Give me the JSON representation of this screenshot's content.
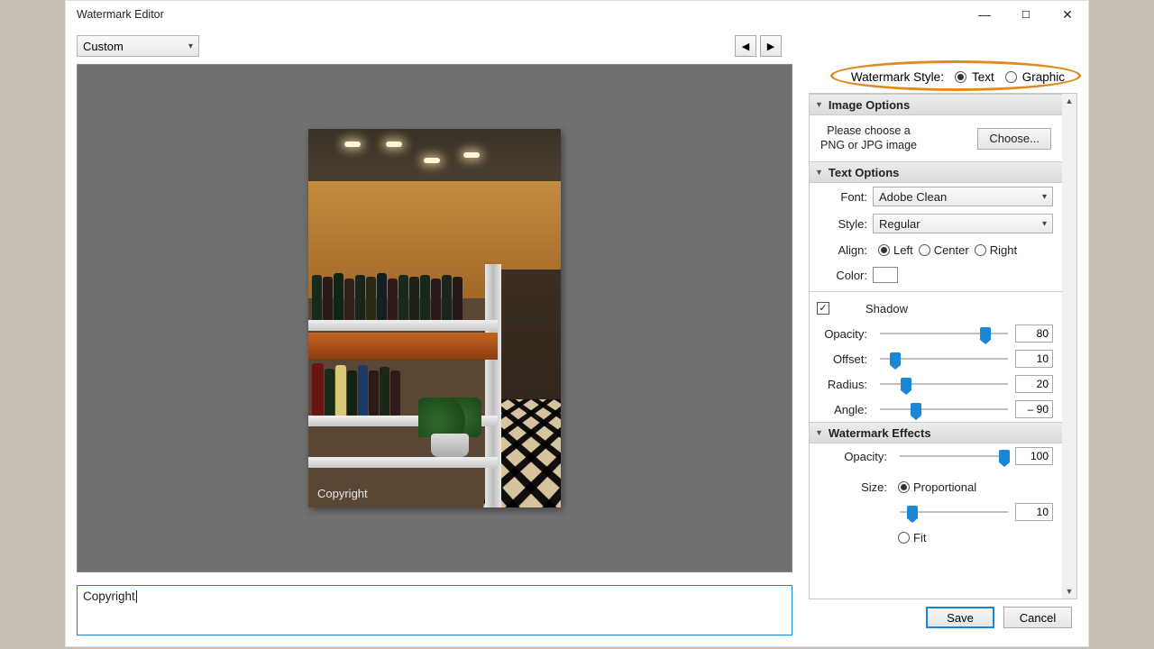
{
  "window": {
    "title": "Watermark Editor"
  },
  "preset": {
    "value": "Custom"
  },
  "watermark_text": "Copyright",
  "caption": "Copyright",
  "style_row": {
    "label": "Watermark Style:",
    "text": "Text",
    "graphic": "Graphic",
    "selected": "text"
  },
  "sections": {
    "image": {
      "title": "Image Options",
      "hint1": "Please choose a",
      "hint2": "PNG or JPG image",
      "choose": "Choose..."
    },
    "text": {
      "title": "Text Options",
      "font_label": "Font:",
      "font_value": "Adobe Clean",
      "style_label": "Style:",
      "style_value": "Regular",
      "align_label": "Align:",
      "align_left": "Left",
      "align_center": "Center",
      "align_right": "Right",
      "color_label": "Color:",
      "shadow_label": "Shadow",
      "opacity_label": "Opacity:",
      "opacity_value": "80",
      "offset_label": "Offset:",
      "offset_value": "10",
      "radius_label": "Radius:",
      "radius_value": "20",
      "angle_label": "Angle:",
      "angle_value": "– 90"
    },
    "effects": {
      "title": "Watermark Effects",
      "opacity_label": "Opacity:",
      "opacity_value": "100",
      "size_label": "Size:",
      "proportional": "Proportional",
      "fit": "Fit",
      "size_value": "10"
    }
  },
  "footer": {
    "save": "Save",
    "cancel": "Cancel"
  },
  "slider_positions": {
    "shadow_opacity": 78,
    "offset": 8,
    "radius": 16,
    "angle": 24,
    "wm_opacity": 92,
    "size": 7
  }
}
